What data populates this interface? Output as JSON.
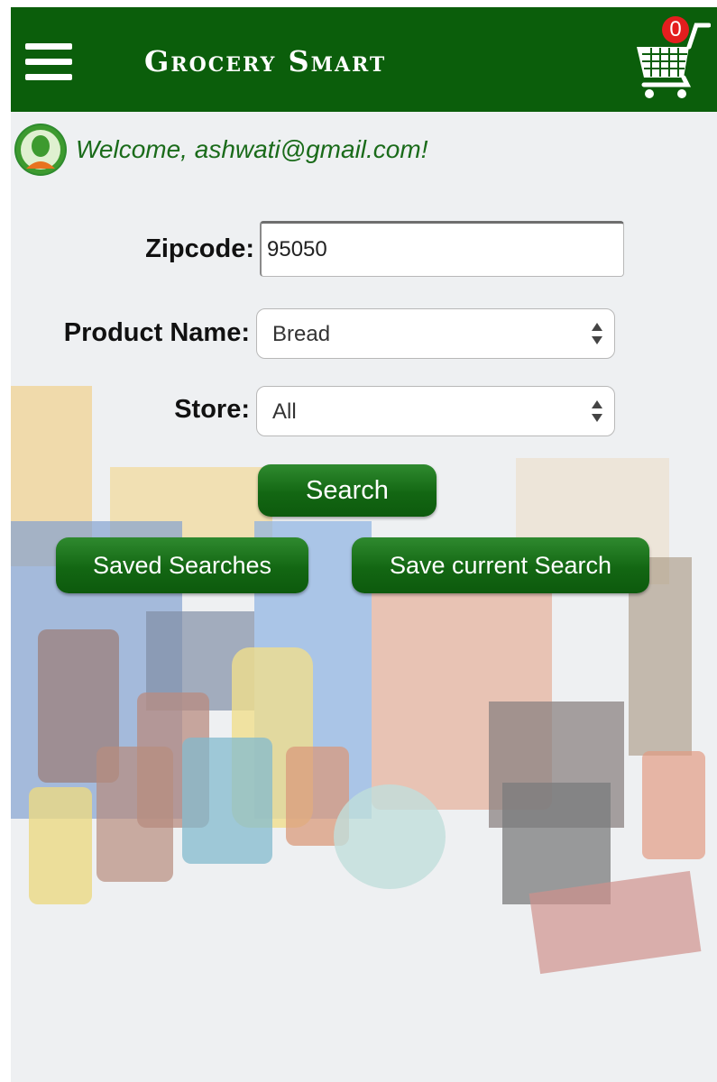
{
  "header": {
    "menu_icon": "hamburger-menu-icon",
    "title": "Grocery Smart",
    "cart_icon": "shopping-cart-icon",
    "cart_count": "0"
  },
  "welcome": {
    "avatar_icon": "user-avatar-icon",
    "text": "Welcome, ashwati@gmail.com!"
  },
  "form": {
    "zipcode_label": "Zipcode:",
    "zipcode_value": "95050",
    "product_label": "Product Name:",
    "product_selected": "Bread",
    "store_label": "Store:",
    "store_selected": "All"
  },
  "buttons": {
    "search": "Search",
    "saved_searches": "Saved Searches",
    "save_current": "Save current Search"
  },
  "colors": {
    "header_bg": "#0b5e0b",
    "button_green": "#136713",
    "badge_red": "#e41e1e",
    "welcome_text": "#1a6b1a"
  }
}
